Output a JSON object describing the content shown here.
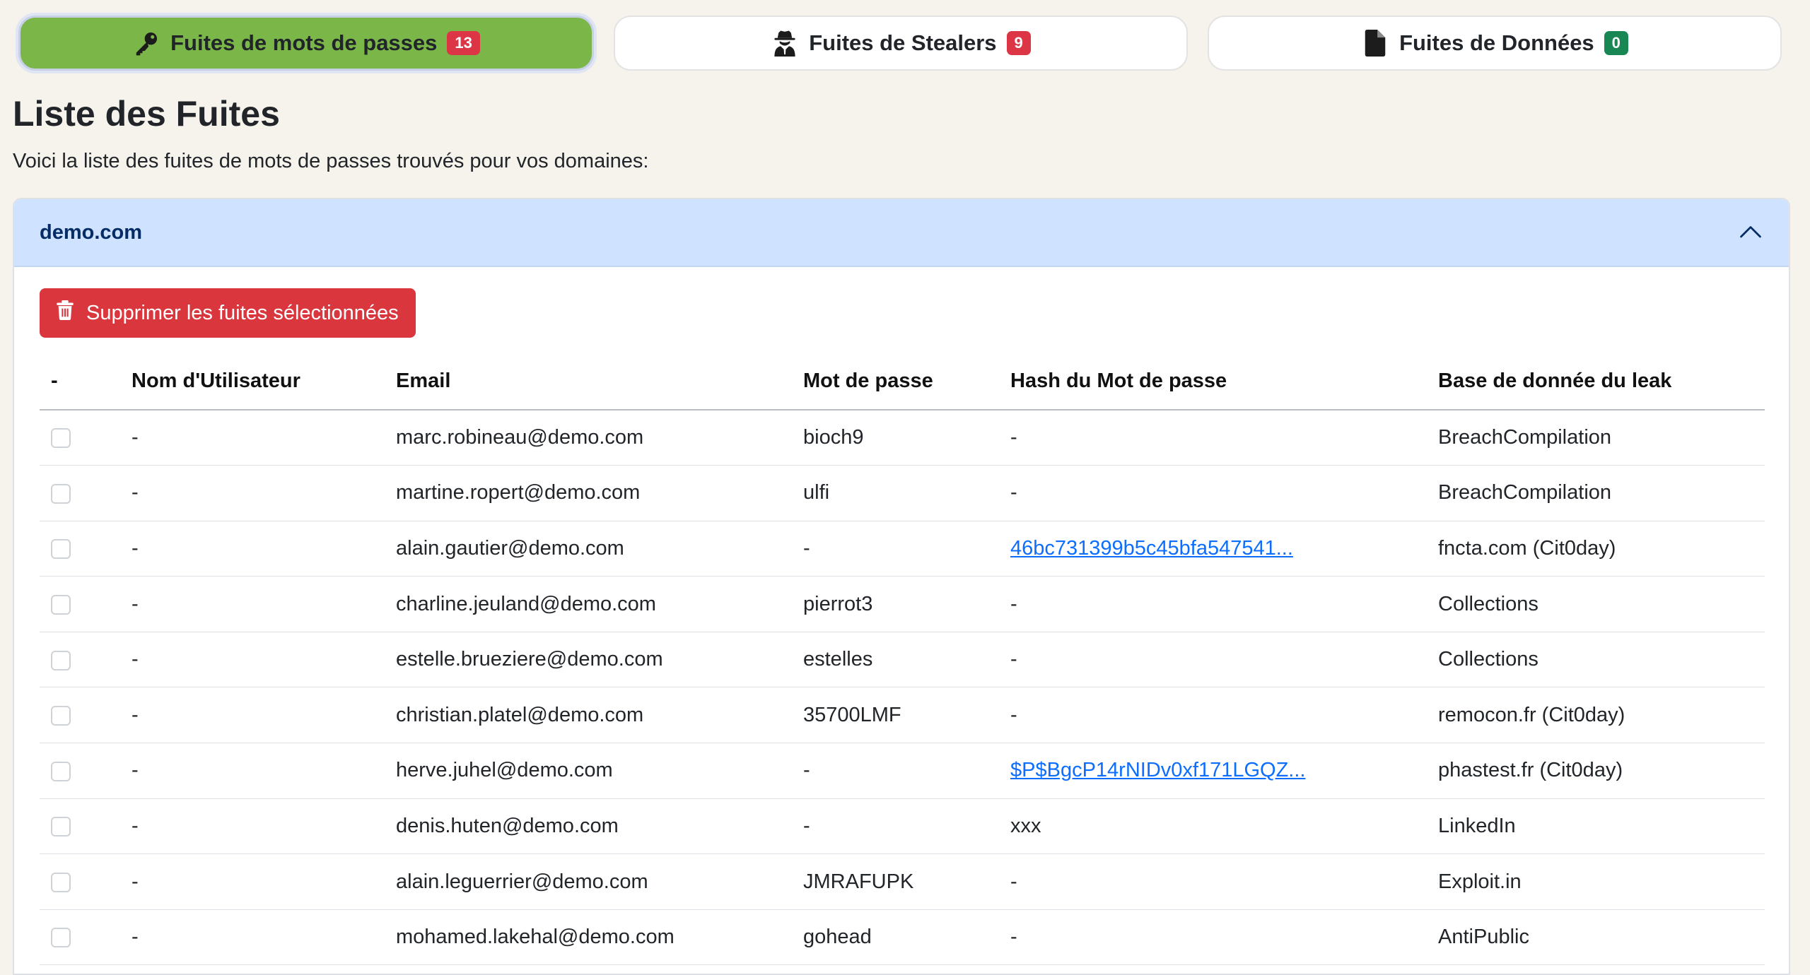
{
  "tabs": [
    {
      "label": "Fuites de mots de passes",
      "count": "13",
      "icon": "key-icon"
    },
    {
      "label": "Fuites de Stealers",
      "count": "9",
      "icon": "user-secret-icon"
    },
    {
      "label": "Fuites de Données",
      "count": "0",
      "icon": "file-icon"
    }
  ],
  "page": {
    "title": "Liste des Fuites",
    "intro": "Voici la liste des fuites de mots de passes trouvés pour vos domaines:"
  },
  "domain": {
    "name": "demo.com",
    "delete_label": "Supprimer les fuites sélectionnées"
  },
  "table": {
    "headers": [
      "-",
      "Nom d'Utilisateur",
      "Email",
      "Mot de passe",
      "Hash du Mot de passe",
      "Base de donnée du leak"
    ],
    "rows": [
      {
        "user": "-",
        "email": "marc.robineau@demo.com",
        "password": "bioch9",
        "hash": "-",
        "hash_link": false,
        "source": "BreachCompilation"
      },
      {
        "user": "-",
        "email": "martine.ropert@demo.com",
        "password": "ulfi",
        "hash": "-",
        "hash_link": false,
        "source": "BreachCompilation"
      },
      {
        "user": "-",
        "email": "alain.gautier@demo.com",
        "password": "-",
        "hash": "46bc731399b5c45bfa547541...",
        "hash_link": true,
        "source": "fncta.com (Cit0day)"
      },
      {
        "user": "-",
        "email": "charline.jeuland@demo.com",
        "password": "pierrot3",
        "hash": "-",
        "hash_link": false,
        "source": "Collections"
      },
      {
        "user": "-",
        "email": "estelle.brueziere@demo.com",
        "password": "estelles",
        "hash": "-",
        "hash_link": false,
        "source": "Collections"
      },
      {
        "user": "-",
        "email": "christian.platel@demo.com",
        "password": "35700LMF",
        "hash": "-",
        "hash_link": false,
        "source": "remocon.fr (Cit0day)"
      },
      {
        "user": "-",
        "email": "herve.juhel@demo.com",
        "password": "-",
        "hash": "$P$BgcP14rNIDv0xf171LGQZ...",
        "hash_link": true,
        "source": "phastest.fr (Cit0day)"
      },
      {
        "user": "-",
        "email": "denis.huten@demo.com",
        "password": "-",
        "hash": "xxx",
        "hash_link": false,
        "source": "LinkedIn"
      },
      {
        "user": "-",
        "email": "alain.leguerrier@demo.com",
        "password": "JMRAFUPK",
        "hash": "-",
        "hash_link": false,
        "source": "Exploit.in"
      },
      {
        "user": "-",
        "email": "mohamed.lakehal@demo.com",
        "password": "gohead",
        "hash": "-",
        "hash_link": false,
        "source": "AntiPublic"
      }
    ]
  },
  "colors": {
    "active_tab": "#7ab648",
    "badge_red": "#dc3545",
    "badge_green": "#198754",
    "accordion_header": "#cfe2ff",
    "delete_button": "#d9363e",
    "link": "#0d6efd"
  }
}
